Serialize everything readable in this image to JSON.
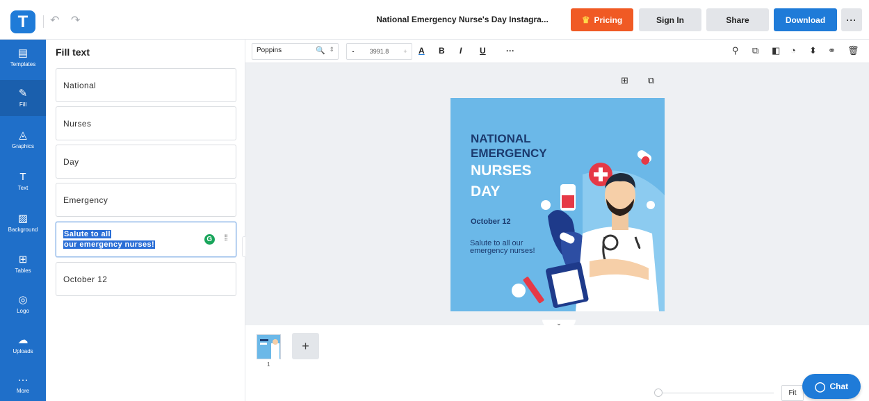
{
  "topbar": {
    "logo_letter": "T",
    "undo_glyph": "↶",
    "redo_glyph": "↷",
    "doc_title": "National Emergency Nurse's Day Instagra...",
    "pricing_label": "Pricing",
    "signin_label": "Sign In",
    "share_label": "Share",
    "download_label": "Download",
    "more_label": "···",
    "accent_color": "#1f7bd8",
    "pricing_color": "#f05a24"
  },
  "sidebar": {
    "items": [
      {
        "label": "Templates",
        "icon": "templates-icon",
        "glyph": "▤"
      },
      {
        "label": "Fill",
        "icon": "pencil-icon",
        "glyph": "✎"
      },
      {
        "label": "Graphics",
        "icon": "shapes-icon",
        "glyph": "◬"
      },
      {
        "label": "Text",
        "icon": "text-icon",
        "glyph": "T"
      },
      {
        "label": "Background",
        "icon": "background-icon",
        "glyph": "▨"
      },
      {
        "label": "Tables",
        "icon": "table-icon",
        "glyph": "⊞"
      },
      {
        "label": "Logo",
        "icon": "logo-icon",
        "glyph": "◎"
      },
      {
        "label": "Uploads",
        "icon": "cloud-upload-icon",
        "glyph": "☁"
      },
      {
        "label": "More",
        "icon": "more-icon",
        "glyph": "···"
      }
    ],
    "active": "Fill"
  },
  "panel": {
    "title": "Fill text",
    "fields": [
      {
        "value": "National"
      },
      {
        "value": "Nurses"
      },
      {
        "value": "Day"
      },
      {
        "value": "Emergency"
      },
      {
        "line1": "Salute to all",
        "line2": "our emergency nurses!"
      },
      {
        "value": "October 12"
      }
    ],
    "grammarly_letter": "G",
    "drag_glyph": "⁞⁞",
    "collapse_glyph": "‹"
  },
  "toolbar": {
    "font_name": "Poppins",
    "search_glyph": "🔍",
    "spin_glyph": "⇕",
    "minus": "-",
    "font_size": "3991.8",
    "plus": "+",
    "color_a": "A",
    "bold": "B",
    "italic": "I",
    "underline": "U",
    "more": "···",
    "right_icons": [
      {
        "icon": "paint-roller-icon",
        "glyph": "⚲"
      },
      {
        "icon": "copy-icon",
        "glyph": "⧉"
      },
      {
        "icon": "layers-icon",
        "glyph": "◧"
      },
      {
        "icon": "opacity-icon",
        "glyph": "◔"
      },
      {
        "icon": "align-icon",
        "glyph": "⬍"
      },
      {
        "icon": "link-icon",
        "glyph": "⚭"
      },
      {
        "icon": "trash-icon",
        "glyph": "🗑"
      }
    ]
  },
  "canvas": {
    "add_glyph": "⊞",
    "duplicate_glyph": "⧉",
    "design": {
      "line1": "NATIONAL",
      "line2": "EMERGENCY",
      "line3": "NURSES",
      "line4": "DAY",
      "date": "October 12",
      "salute": "Salute to all our emergency nurses!",
      "bg_color": "#6bb8e8"
    },
    "expand_glyph": "⌄"
  },
  "pages": {
    "page_number": "1",
    "add_glyph": "+",
    "fit_label": "Fit",
    "chat_label": "Chat",
    "chat_glyph": "◯"
  }
}
